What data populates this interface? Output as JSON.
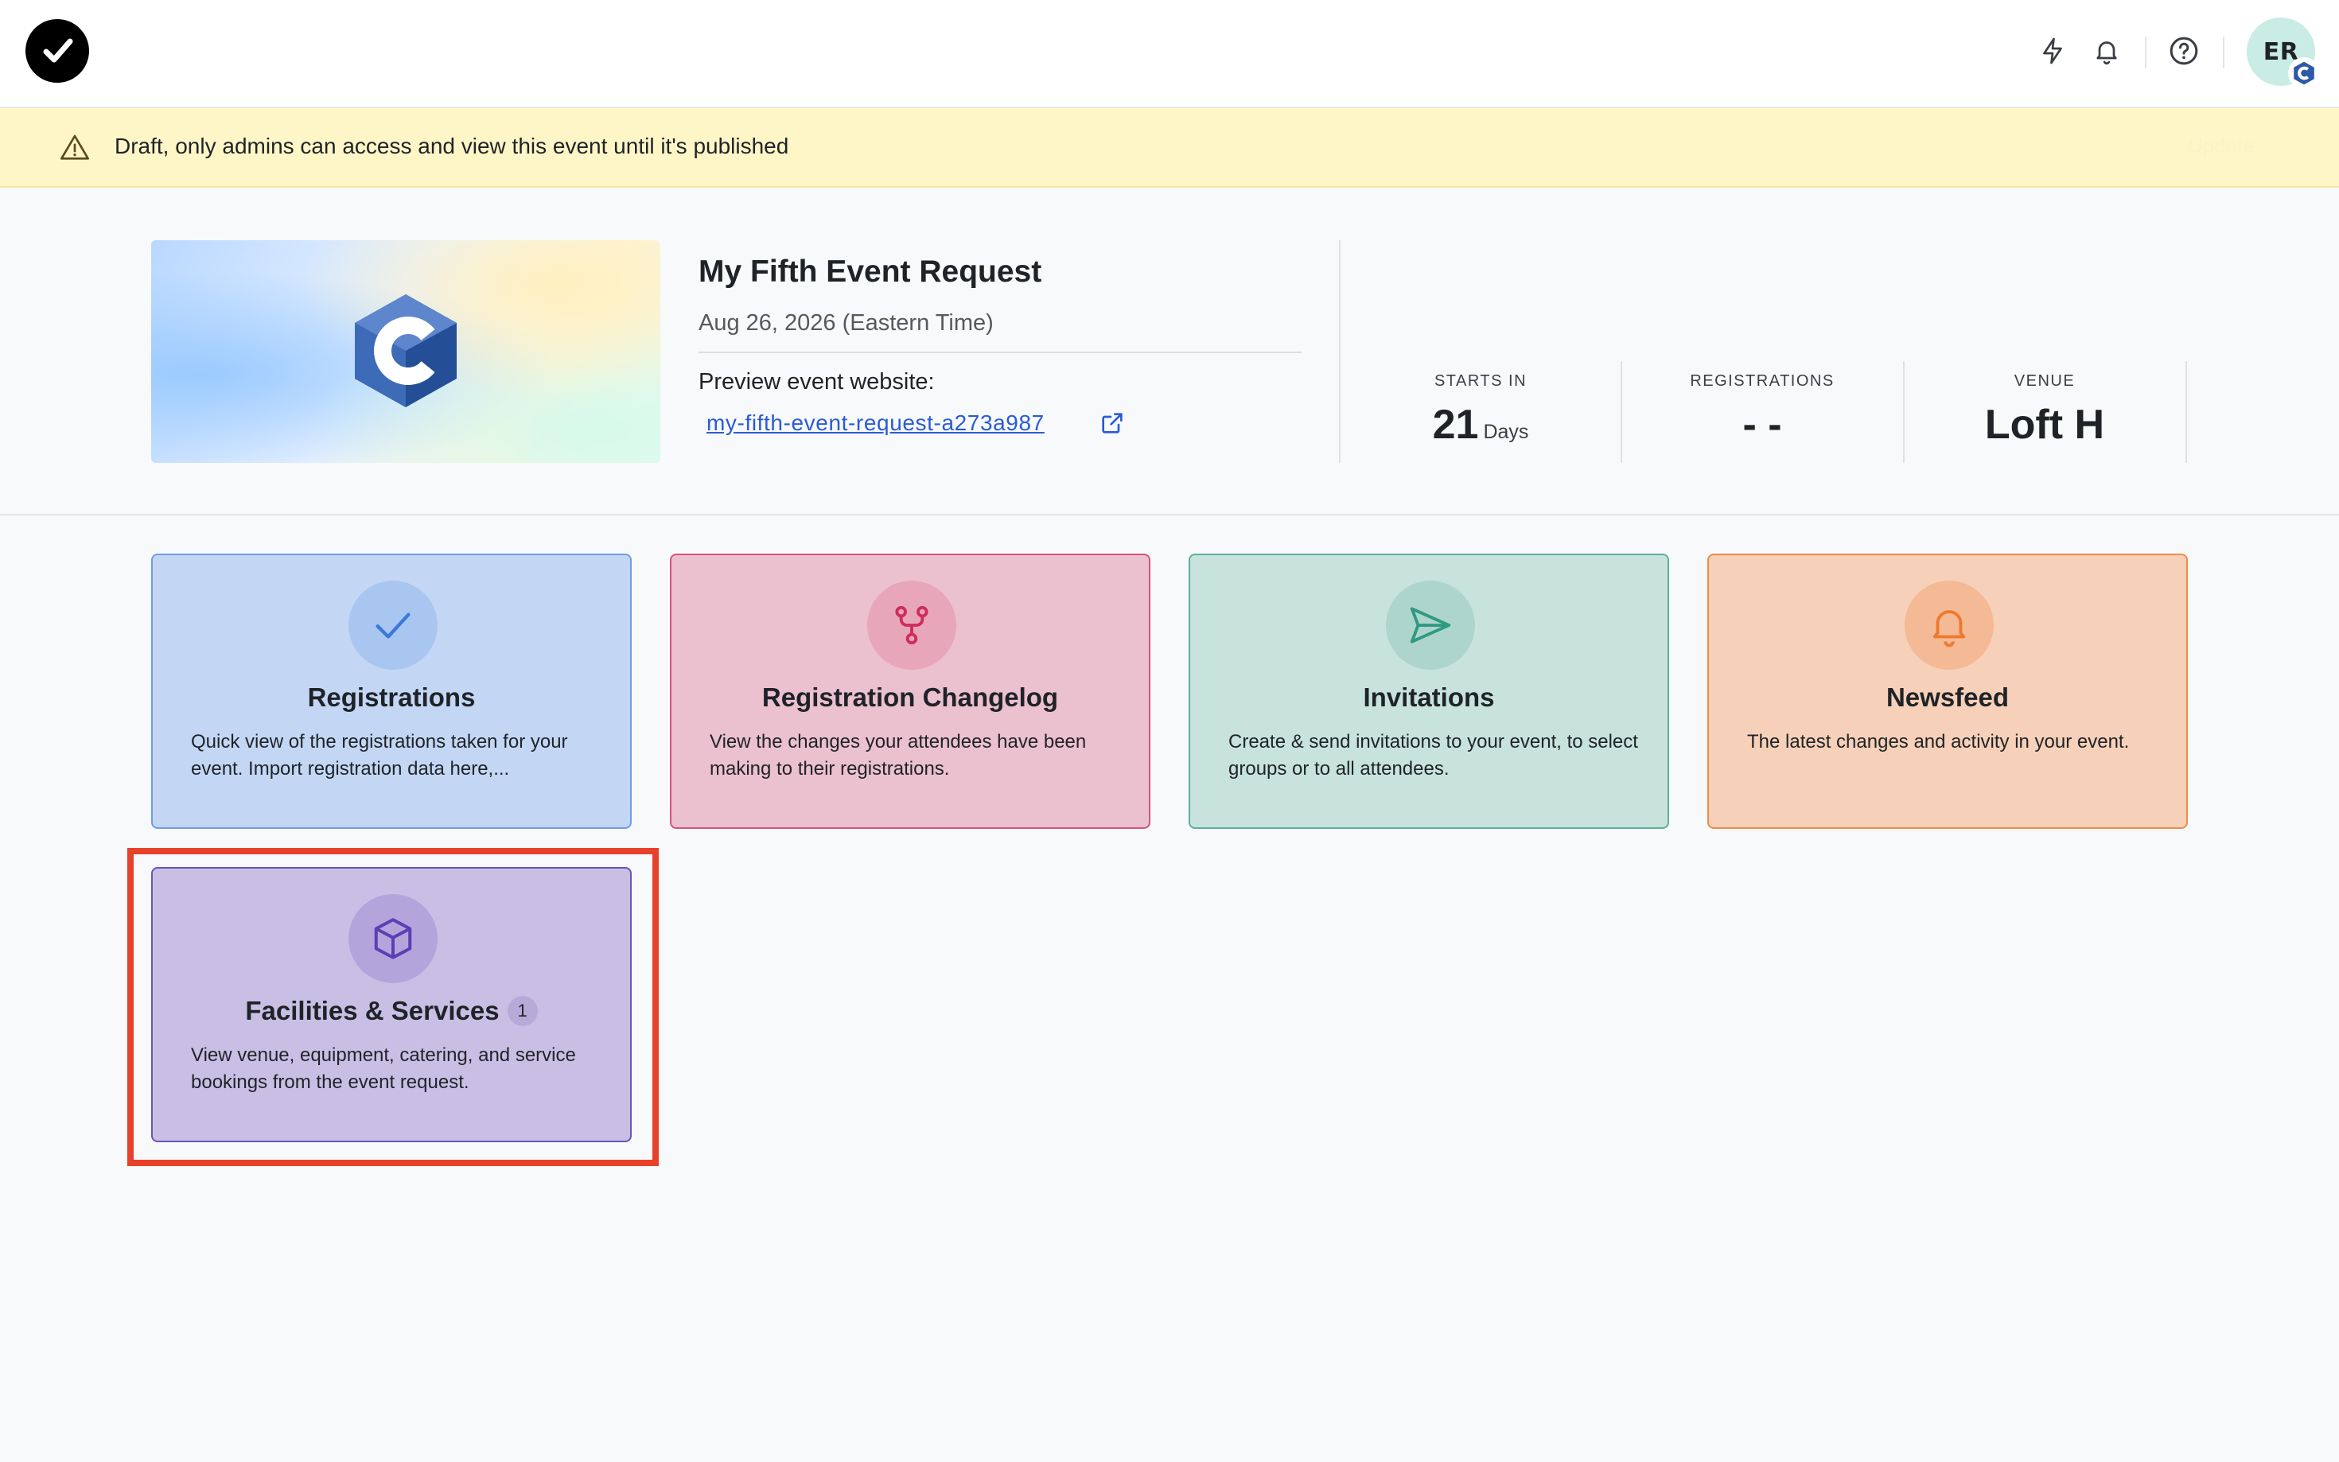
{
  "header": {
    "avatar_initials": "ER",
    "icons": [
      "lightning-icon",
      "bell-icon",
      "help-icon"
    ]
  },
  "banner": {
    "text": "Draft, only admins can access and view this event until it's published",
    "action": "Update"
  },
  "event": {
    "title": "My Fifth Event Request",
    "date": "Aug 26, 2026 (Eastern Time)",
    "preview_label": "Preview event website:",
    "preview_link": "my-fifth-event-request-a273a987"
  },
  "stats": {
    "starts_in_label": "STARTS IN",
    "starts_in_value": "21",
    "starts_in_unit": "Days",
    "registrations_label": "REGISTRATIONS",
    "registrations_value": "- -",
    "venue_label": "VENUE",
    "venue_value": "Loft H"
  },
  "cards": [
    {
      "title": "Registrations",
      "description": "Quick view of the registrations taken for your event. Import registration data here,...",
      "icon": "check-icon",
      "color": "#c3d7f4"
    },
    {
      "title": "Registration Changelog",
      "description": "View the changes your attendees have been making to their registrations.",
      "icon": "branch-icon",
      "color": "#ebc0cf"
    },
    {
      "title": "Invitations",
      "description": "Create & send invitations to your event, to select groups or to all attendees.",
      "icon": "send-icon",
      "color": "#c7e3dc"
    },
    {
      "title": "Newsfeed",
      "description": "The latest changes and activity in your event.",
      "icon": "bell-icon",
      "color": "#f6d0b8"
    },
    {
      "title": "Facilities & Services",
      "badge": "1",
      "description": "View venue, equipment, catering, and service bookings from the event request.",
      "icon": "box-icon",
      "color": "#c9bfe5"
    }
  ],
  "colors": {
    "accent_link": "#2a5bd7",
    "banner_bg": "#fef6c7",
    "highlight": "#e8412b"
  }
}
